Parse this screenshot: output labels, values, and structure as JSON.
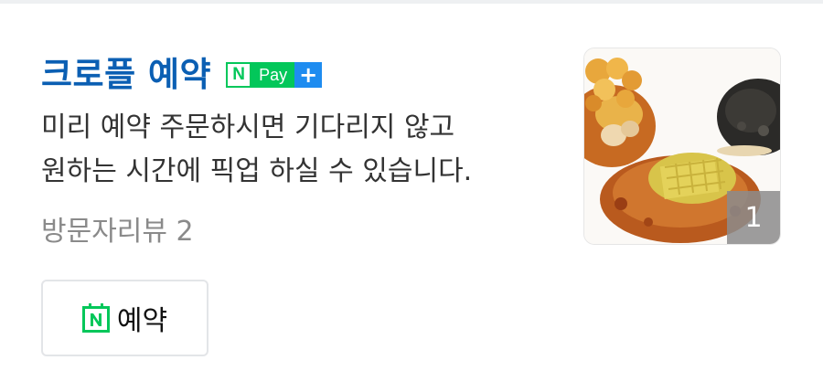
{
  "place": {
    "title": "크로플 예약",
    "badge": {
      "n_label": "N",
      "pay_label": "Pay",
      "plus_label": "+"
    },
    "description_lines": [
      "미리 예약 주문하시면 기다리지 않고",
      "원하는 시간에 픽업 하실 수 있습니다."
    ],
    "review_text": "방문자리뷰 2",
    "photo_count": "1",
    "reserve_button": {
      "icon": "naver-booking-calendar-icon",
      "label": "예약"
    }
  },
  "colors": {
    "title": "#0b5fb3",
    "naver_green": "#03c75a",
    "plus_blue": "#1e8cf0",
    "review_gray": "#8a8a8a"
  }
}
